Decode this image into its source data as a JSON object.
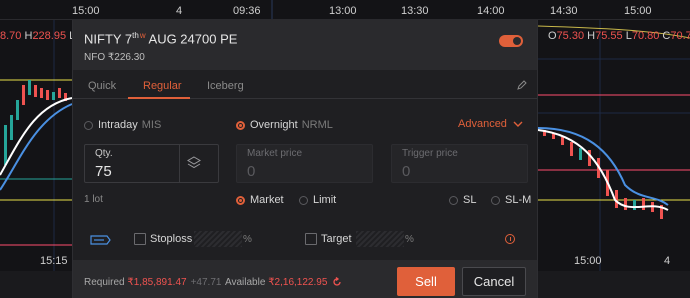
{
  "chart": {
    "top_axis": [
      "15:00",
      "4",
      "09:36",
      "13:00",
      "13:30",
      "14:00",
      "14:30",
      "15:00"
    ],
    "bottom_axis": [
      "15:15",
      "15:00",
      "4"
    ],
    "ohlc_left": {
      "o_val": "8.70",
      "h_label": "H",
      "h_val": "228.95",
      "l_label": "L"
    },
    "ohlc_right": {
      "o_label": "O",
      "o_val": "75.30",
      "h_label": "H",
      "h_val": "75.55",
      "l_label": "L",
      "l_val": "70.80",
      "c_label": "C",
      "c_val": "70.75"
    },
    "colors": {
      "down": "#ef5350",
      "up": "#26a69a",
      "bg": "#131316"
    }
  },
  "order": {
    "instrument": "NIFTY 7",
    "instrument_suffix": "th",
    "weekly_tag": "w",
    "instrument_rest": " AUG 24700 PE",
    "exchange": "NFO",
    "ltp": "₹226.30",
    "tabs": [
      "Quick",
      "Regular",
      "Iceberg"
    ],
    "active_tab": "Regular",
    "product": {
      "intraday": "Intraday",
      "intraday_code": "MIS",
      "overnight": "Overnight",
      "overnight_code": "NRML",
      "selected": "Overnight"
    },
    "advanced_label": "Advanced",
    "qty": {
      "label": "Qty.",
      "value": "75"
    },
    "market_price": {
      "label": "Market price",
      "value": "0"
    },
    "trigger_price": {
      "label": "Trigger price",
      "value": "0"
    },
    "lot_text": "1 lot",
    "order_types": {
      "market": "Market",
      "limit": "Limit",
      "sl": "SL",
      "slm": "SL-M",
      "selected": "Market"
    },
    "gtt_icon": "gtt-icon",
    "stoploss_label": "Stoploss",
    "target_label": "Target",
    "pct_sign": "%",
    "required_label": "Required",
    "required_value": "₹1,85,891.47",
    "required_delta": "+47.71",
    "available_label": "Available",
    "available_value": "₹2,16,122.95",
    "sell_label": "Sell",
    "cancel_label": "Cancel",
    "accent_color": "#e0603a"
  }
}
